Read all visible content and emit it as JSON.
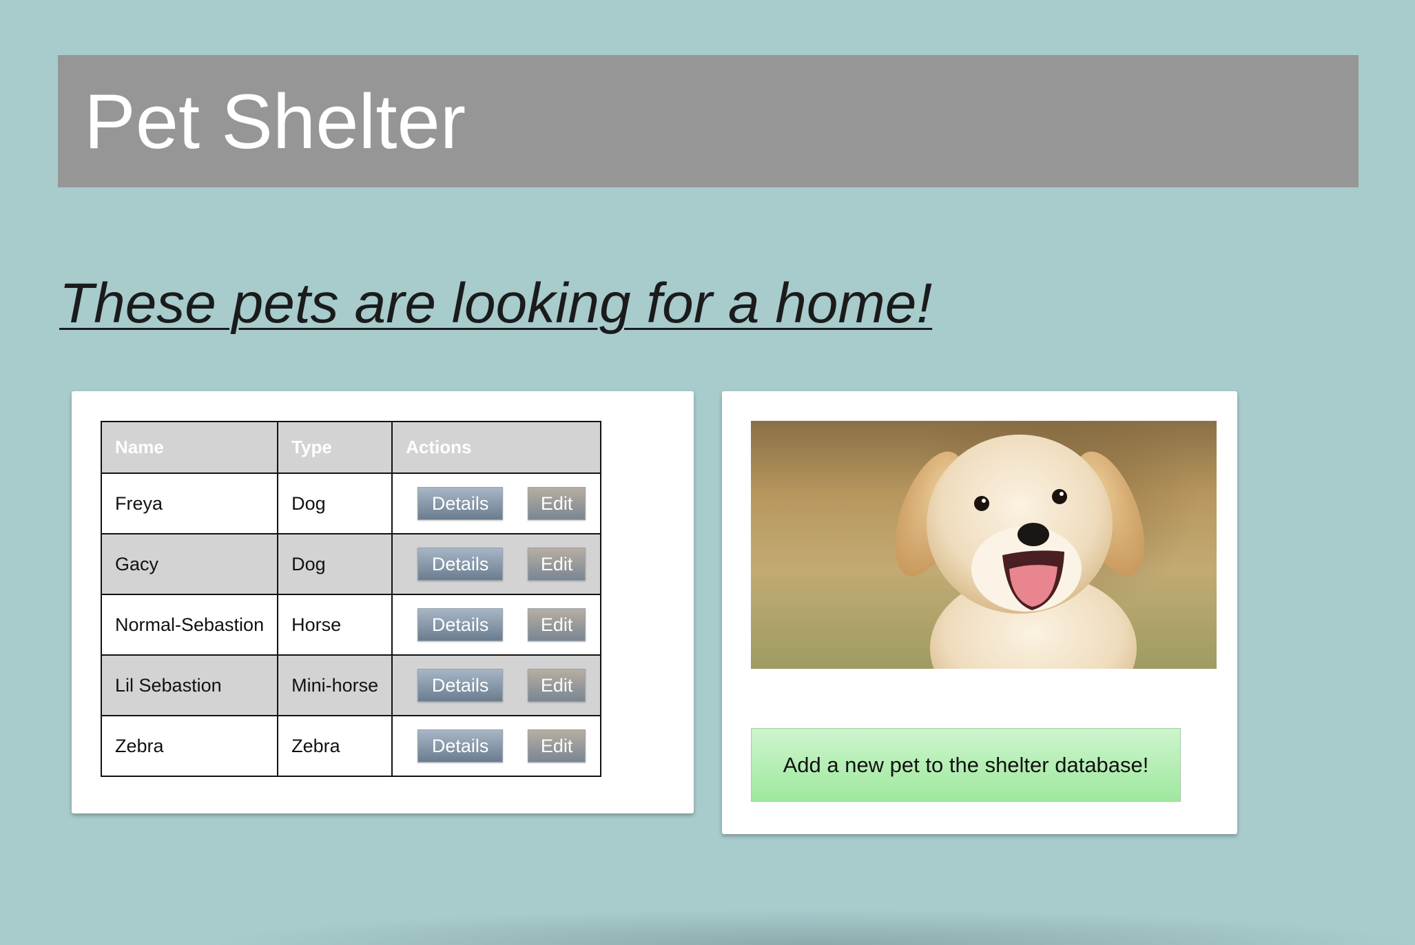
{
  "header": {
    "title": "Pet Shelter"
  },
  "tagline": "These pets are looking for a home!",
  "table": {
    "columns": [
      "Name",
      "Type",
      "Actions"
    ],
    "rows": [
      {
        "name": "Freya",
        "type": "Dog"
      },
      {
        "name": "Gacy",
        "type": "Dog"
      },
      {
        "name": "Normal-Sebastion",
        "type": "Horse"
      },
      {
        "name": "Lil Sebastion",
        "type": "Mini-horse"
      },
      {
        "name": "Zebra",
        "type": "Zebra"
      }
    ],
    "details_label": "Details",
    "edit_label": "Edit"
  },
  "image": {
    "subject": "golden-retriever-puppy-photo"
  },
  "add_button_label": "Add a new pet to the shelter database!",
  "colors": {
    "background": "#a8cbcc",
    "header": "#969696",
    "add_button": "#9ee89e",
    "table_stripe": "#d3d3d3"
  }
}
